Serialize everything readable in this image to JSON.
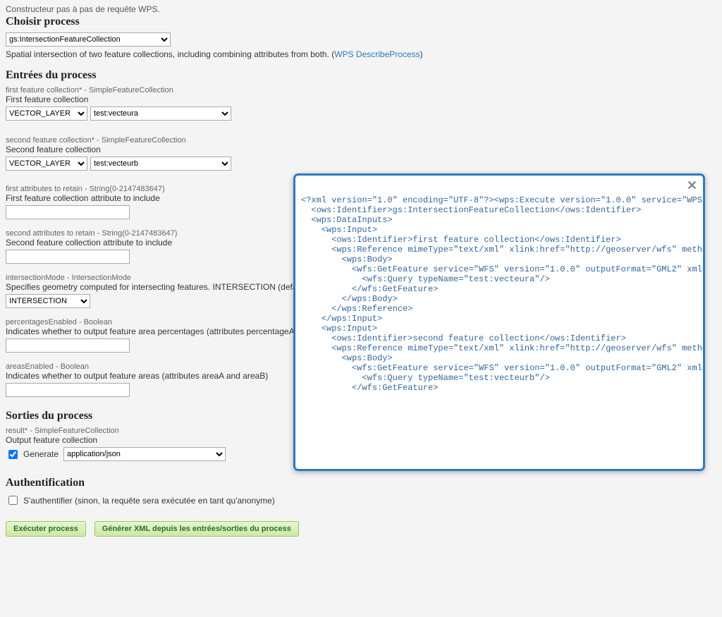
{
  "top_subtitle": "Constructeur pas à pas de requête WPS.",
  "choose": {
    "heading": "Choisir process",
    "select_value": "gs:IntersectionFeatureCollection",
    "desc_prefix": "Spatial intersection of two feature collections, including combining attributes from both. (",
    "desc_link": "WPS DescribeProcess",
    "desc_suffix": ")"
  },
  "inputs_heading": "Entrées du process",
  "inputs": {
    "first_fc": {
      "param": "first feature collection* - SimpleFeatureCollection",
      "desc": "First feature collection",
      "type_select": "VECTOR_LAYER",
      "layer_select": "test:vecteura"
    },
    "second_fc": {
      "param": "second feature collection* - SimpleFeatureCollection",
      "desc": "Second feature collection",
      "type_select": "VECTOR_LAYER",
      "layer_select": "test:vecteurb"
    },
    "first_attr": {
      "param": "first attributes to retain - String(0-2147483647)",
      "desc": "First feature collection attribute to include",
      "value": ""
    },
    "second_attr": {
      "param": "second attributes to retain - String(0-2147483647)",
      "desc": "Second feature collection attribute to include",
      "value": ""
    },
    "intersection_mode": {
      "param": "intersectionMode - IntersectionMode",
      "desc": "Specifies geometry computed for intersecting features. INTERSECTION (default) computes the spatial intersection of the inputs. FIRST copies geometry A. SECOND copies geometry B.",
      "value": "INTERSECTION"
    },
    "percentages": {
      "param": "percentagesEnabled - Boolean",
      "desc": "Indicates whether to output feature area percentages (attributes percentageA and percentageB)",
      "value": ""
    },
    "areas": {
      "param": "areasEnabled - Boolean",
      "desc": "Indicates whether to output feature areas (attributes areaA and areaB)",
      "value": ""
    }
  },
  "outputs_heading": "Sorties du process",
  "outputs": {
    "result": {
      "param": "result* - SimpleFeatureCollection",
      "desc": "Output feature collection",
      "generate_label": "Generate",
      "format_value": "application/json"
    }
  },
  "auth": {
    "heading": "Authentification",
    "label": "S'authentifier (sinon, la requête sera exécutée en tant qu'anonyme)"
  },
  "buttons": {
    "execute": "Exécuter process",
    "generate_xml": "Générer XML depuis les entrées/sorties du process"
  },
  "modal": {
    "xml": "<?xml version=\"1.0\" encoding=\"UTF-8\"?><wps:Execute version=\"1.0.0\" service=\"WPS\" xmlns:wps=\"http://www.opengis.net/wps/1.0.0\">\n  <ows:Identifier>gs:IntersectionFeatureCollection</ows:Identifier>\n  <wps:DataInputs>\n    <wps:Input>\n      <ows:Identifier>first feature collection</ows:Identifier>\n      <wps:Reference mimeType=\"text/xml\" xlink:href=\"http://geoserver/wfs\" method=\"POST\">\n        <wps:Body>\n          <wfs:GetFeature service=\"WFS\" version=\"1.0.0\" outputFormat=\"GML2\" xmlns:wfs=\"http://www.opengis.net/wfs\">\n            <wfs:Query typeName=\"test:vecteura\"/>\n          </wfs:GetFeature>\n        </wps:Body>\n      </wps:Reference>\n    </wps:Input>\n    <wps:Input>\n      <ows:Identifier>second feature collection</ows:Identifier>\n      <wps:Reference mimeType=\"text/xml\" xlink:href=\"http://geoserver/wfs\" method=\"POST\">\n        <wps:Body>\n          <wfs:GetFeature service=\"WFS\" version=\"1.0.0\" outputFormat=\"GML2\" xmlns:wfs=\"http://www.opengis.net/wfs\">\n            <wfs:Query typeName=\"test:vecteurb\"/>\n          </wfs:GetFeature>\n"
  }
}
